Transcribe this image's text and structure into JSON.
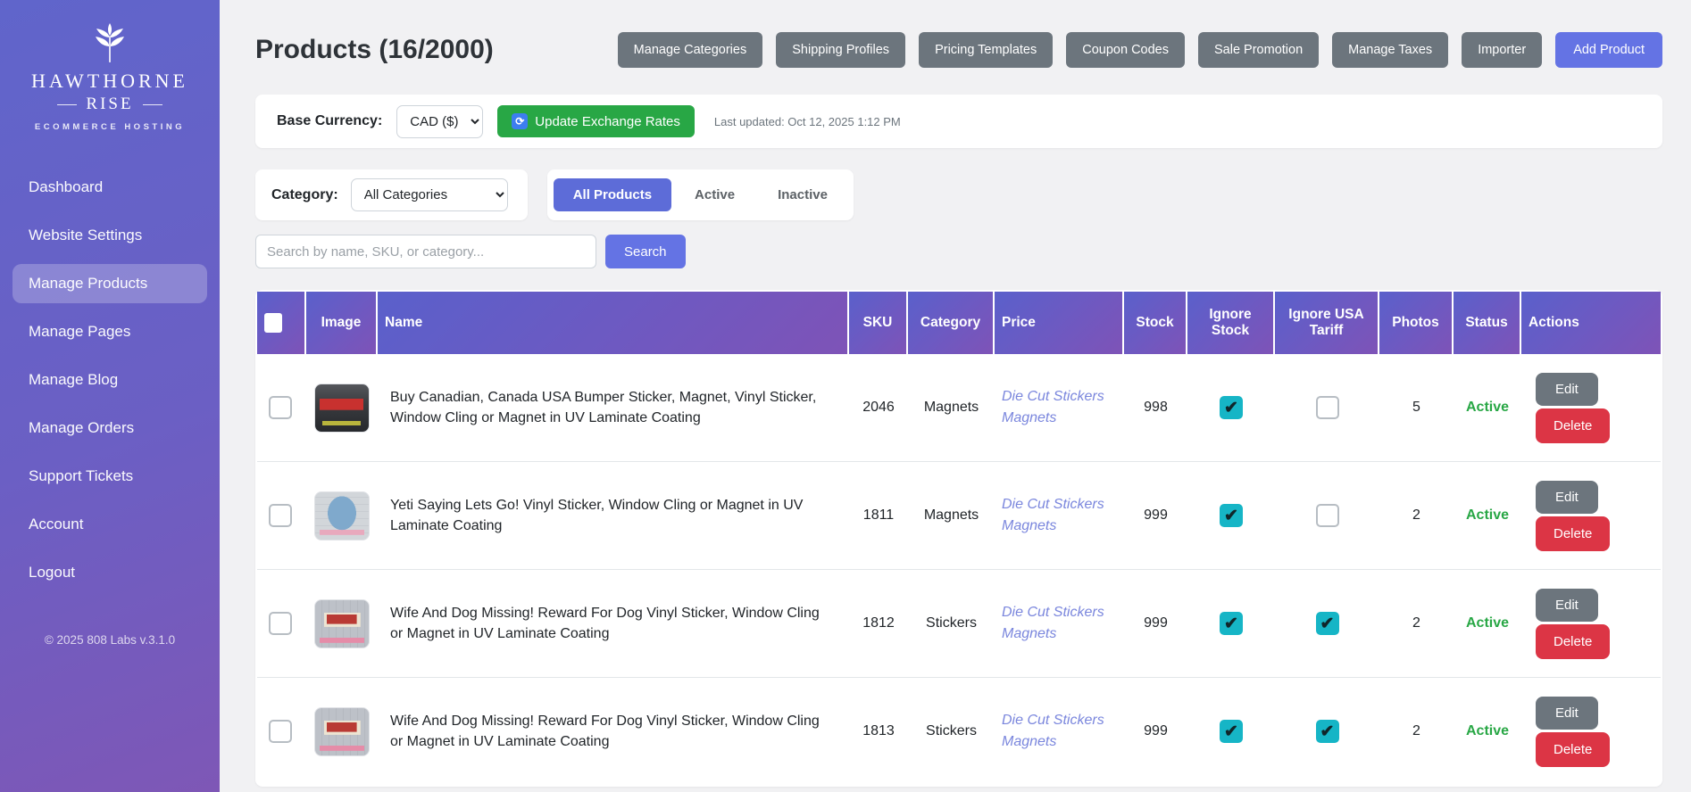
{
  "sidebar": {
    "logo": {
      "title": "HAWTHORNE",
      "subtitle": "RISE",
      "tagline": "ECOMMERCE HOSTING"
    },
    "items": [
      {
        "label": "Dashboard",
        "active": false
      },
      {
        "label": "Website Settings",
        "active": false
      },
      {
        "label": "Manage Products",
        "active": true
      },
      {
        "label": "Manage Pages",
        "active": false
      },
      {
        "label": "Manage Blog",
        "active": false
      },
      {
        "label": "Manage Orders",
        "active": false
      },
      {
        "label": "Support Tickets",
        "active": false
      },
      {
        "label": "Account",
        "active": false
      },
      {
        "label": "Logout",
        "active": false
      }
    ],
    "copyright": "© 2025 808 Labs v.3.1.0"
  },
  "header": {
    "title": "Products (16/2000)",
    "buttons": [
      "Manage Categories",
      "Shipping Profiles",
      "Pricing Templates",
      "Coupon Codes",
      "Sale Promotion",
      "Manage Taxes",
      "Importer"
    ],
    "add_product_label": "Add Product"
  },
  "currency_bar": {
    "label": "Base Currency:",
    "selected_currency": "CAD ($)",
    "update_button": "Update Exchange Rates",
    "update_icon": "refresh-icon",
    "last_updated": "Last updated: Oct 12, 2025 1:12 PM"
  },
  "filters": {
    "category_label": "Category:",
    "category_selected": "All Categories",
    "tabs": [
      {
        "label": "All Products",
        "active": true
      },
      {
        "label": "Active",
        "active": false
      },
      {
        "label": "Inactive",
        "active": false
      }
    ]
  },
  "search": {
    "placeholder": "Search by name, SKU, or category...",
    "button": "Search"
  },
  "table": {
    "columns": [
      "Image",
      "Name",
      "SKU",
      "Category",
      "Price",
      "Stock",
      "Ignore Stock",
      "Ignore USA Tariff",
      "Photos",
      "Status",
      "Actions"
    ],
    "actions": {
      "edit": "Edit",
      "delete": "Delete"
    },
    "rows": [
      {
        "selected": false,
        "thumb": "buy-canadian",
        "name": "Buy Canadian, Canada USA Bumper Sticker, Magnet, Vinyl Sticker, Window Cling or Magnet in UV Laminate Coating",
        "sku": "2046",
        "category": "Magnets",
        "price_link": "Die Cut Stickers Magnets",
        "stock": "998",
        "ignore_stock": true,
        "ignore_usa_tariff": false,
        "photos": "5",
        "status": "Active"
      },
      {
        "selected": false,
        "thumb": "yeti",
        "name": "Yeti Saying Lets Go! Vinyl Sticker, Window Cling or Magnet in UV Laminate Coating",
        "sku": "1811",
        "category": "Magnets",
        "price_link": "Die Cut Stickers Magnets",
        "stock": "999",
        "ignore_stock": true,
        "ignore_usa_tariff": false,
        "photos": "2",
        "status": "Active"
      },
      {
        "selected": false,
        "thumb": "wife-dog",
        "name": "Wife And Dog Missing! Reward For Dog Vinyl Sticker, Window Cling or Magnet in UV Laminate Coating",
        "sku": "1812",
        "category": "Stickers",
        "price_link": "Die Cut Stickers Magnets",
        "stock": "999",
        "ignore_stock": true,
        "ignore_usa_tariff": true,
        "photos": "2",
        "status": "Active"
      },
      {
        "selected": false,
        "thumb": "wife-dog",
        "name": "Wife And Dog Missing! Reward For Dog Vinyl Sticker, Window Cling or Magnet in UV Laminate Coating",
        "sku": "1813",
        "category": "Stickers",
        "price_link": "Die Cut Stickers Magnets",
        "stock": "999",
        "ignore_stock": true,
        "ignore_usa_tariff": true,
        "photos": "2",
        "status": "Active"
      }
    ]
  },
  "colors": {
    "sidebar_gradient_top": "#6065cb",
    "sidebar_gradient_bottom": "#7e57b6",
    "accent_indigo": "#6473e4",
    "accent_green": "#28a745",
    "accent_red": "#dc3545",
    "accent_gray": "#6c757d",
    "checkbox_teal": "#16b5c6",
    "status_active_green": "#28a745",
    "link_indigo": "#7a86dd"
  }
}
